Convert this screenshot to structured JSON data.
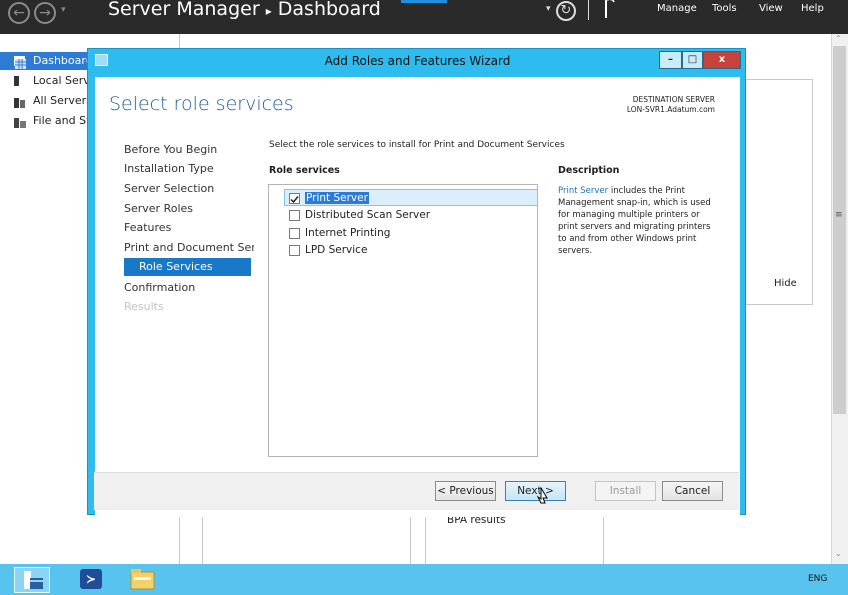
{
  "server_manager": {
    "title": "Server Manager",
    "breadcrumb_sep": "▸",
    "breadcrumb": "Dashboard",
    "menu": [
      "Manage",
      "Tools",
      "View",
      "Help"
    ],
    "refresh_icon": "refresh-icon",
    "flag_icon": "flag-icon",
    "nav_items": [
      {
        "label": "Dashboard",
        "icon": "dashboard-icon"
      },
      {
        "label": "Local Server",
        "icon": "server-icon"
      },
      {
        "label": "All Servers",
        "icon": "servers-icon"
      },
      {
        "label": "File and Storage Services",
        "icon": "storage-icon"
      }
    ],
    "hide_label": "Hide",
    "bpa_label": "BPA results"
  },
  "wizard": {
    "title": "Add Roles and Features Wizard",
    "heading": "Select role services",
    "destination_label": "DESTINATION SERVER",
    "destination_server": "LON-SVR1.Adatum.com",
    "instruction": "Select the role services to install for Print and Document Services",
    "steps": [
      {
        "label": "Before You Begin",
        "state": "normal"
      },
      {
        "label": "Installation Type",
        "state": "normal"
      },
      {
        "label": "Server Selection",
        "state": "normal"
      },
      {
        "label": "Server Roles",
        "state": "normal"
      },
      {
        "label": "Features",
        "state": "normal"
      },
      {
        "label": "Print and Document Servi...",
        "state": "normal"
      },
      {
        "label": "Role Services",
        "state": "active"
      },
      {
        "label": "Confirmation",
        "state": "normal"
      },
      {
        "label": "Results",
        "state": "disabled"
      }
    ],
    "role_services_header": "Role services",
    "role_services": [
      {
        "label": "Print Server",
        "checked": true,
        "selected": true
      },
      {
        "label": "Distributed Scan Server",
        "checked": false
      },
      {
        "label": "Internet Printing",
        "checked": false
      },
      {
        "label": "LPD Service",
        "checked": false
      }
    ],
    "description_header": "Description",
    "description_link": "Print Server",
    "description_text": " includes the Print Management snap-in, which is used for managing multiple printers or print servers and migrating printers to and from other Windows print servers.",
    "buttons": {
      "previous": "< Previous",
      "next": "Next >",
      "install": "Install",
      "cancel": "Cancel"
    },
    "window_buttons": {
      "minimize": "–",
      "maximize": "□",
      "close": "x"
    }
  },
  "taskbar": {
    "items": [
      "server-manager-icon",
      "powershell-icon",
      "file-explorer-icon"
    ],
    "language": "ENG"
  },
  "colors": {
    "wizard_frame": "#2ebbee",
    "taskbar": "#59c3f0",
    "selection": "#1879c9",
    "link": "#1a6fb5"
  }
}
